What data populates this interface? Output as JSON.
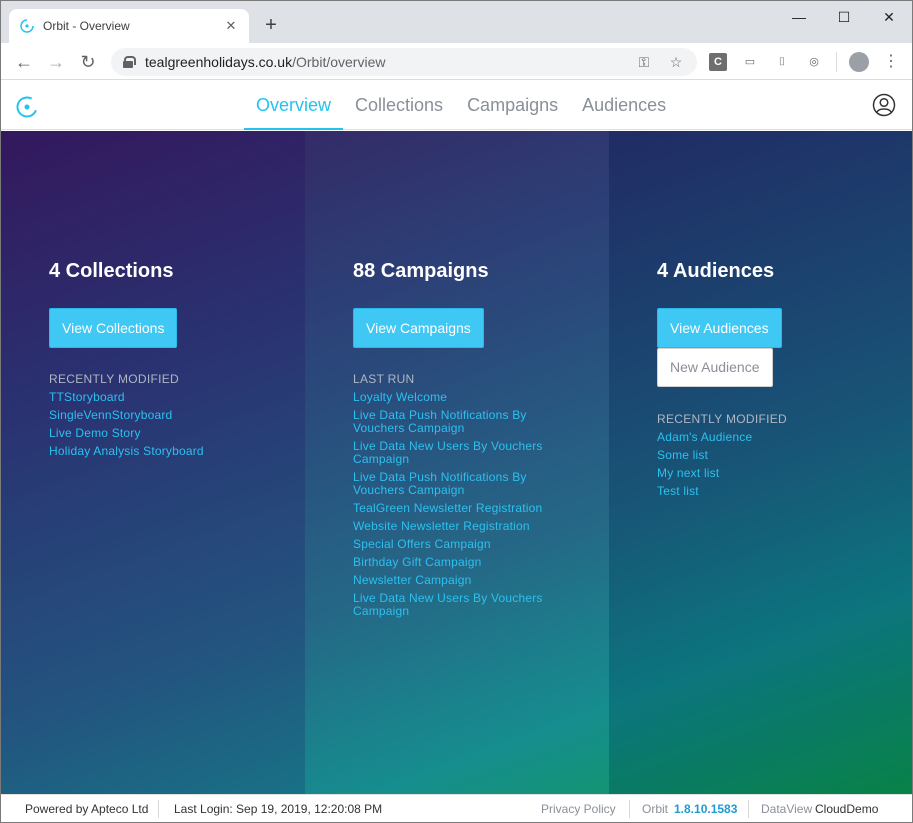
{
  "browser": {
    "tab_title": "Orbit - Overview",
    "url_host": "tealgreenholidays.co.uk",
    "url_path": "/Orbit/overview",
    "ext_c": "C"
  },
  "app": {
    "nav": [
      "Overview",
      "Collections",
      "Campaigns",
      "Audiences"
    ],
    "active_nav": "Overview",
    "accent": "#24c3ef"
  },
  "collections": {
    "title": "4 Collections",
    "button": "View Collections",
    "section_label": "RECENTLY MODIFIED",
    "items": [
      "TTStoryboard",
      "SingleVennStoryboard",
      "Live Demo Story",
      "Holiday Analysis Storyboard"
    ]
  },
  "campaigns": {
    "title": "88 Campaigns",
    "button": "View Campaigns",
    "section_label": "LAST RUN",
    "items": [
      "Loyalty Welcome",
      "Live Data Push Notifications By Vouchers Campaign",
      "Live Data New Users By Vouchers Campaign",
      "Live Data Push Notifications By Vouchers Campaign",
      "TealGreen Newsletter Registration",
      "Website Newsletter Registration",
      "Special Offers Campaign",
      "Birthday Gift Campaign",
      "Newsletter Campaign",
      "Live Data New Users By Vouchers Campaign"
    ]
  },
  "audiences": {
    "title": "4 Audiences",
    "button": "View Audiences",
    "button_secondary": "New Audience",
    "section_label": "RECENTLY MODIFIED",
    "items": [
      "Adam's Audience",
      "Some list",
      "My next list",
      "Test list"
    ]
  },
  "footer": {
    "powered": "Powered by Apteco Ltd",
    "last_login": "Last Login: Sep 19, 2019, 12:20:08 PM",
    "privacy": "Privacy Policy",
    "orbit_label": "Orbit",
    "orbit_version": "1.8.10.1583",
    "dataview_label": "DataView",
    "dataview_name": "CloudDemo"
  }
}
